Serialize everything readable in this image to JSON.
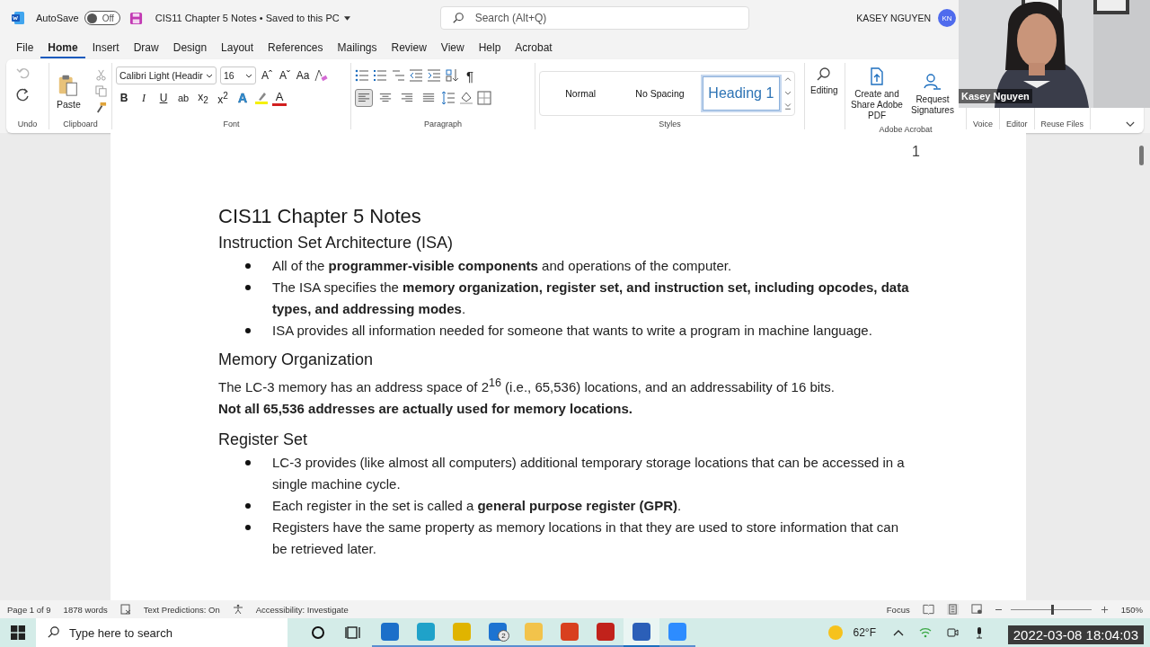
{
  "title_bar": {
    "autosave_label": "AutoSave",
    "autosave_on": false,
    "autosave_state": "Off",
    "doc_title": "CIS11 Chapter 5 Notes • Saved to this PC",
    "search_placeholder": "Search (Alt+Q)",
    "user_name": "KASEY NGUYEN",
    "user_initials": "KN"
  },
  "menu_tabs": [
    {
      "label": "File",
      "selected": false
    },
    {
      "label": "Home",
      "selected": true
    },
    {
      "label": "Insert",
      "selected": false
    },
    {
      "label": "Draw",
      "selected": false
    },
    {
      "label": "Design",
      "selected": false
    },
    {
      "label": "Layout",
      "selected": false
    },
    {
      "label": "References",
      "selected": false
    },
    {
      "label": "Mailings",
      "selected": false
    },
    {
      "label": "Review",
      "selected": false
    },
    {
      "label": "View",
      "selected": false
    },
    {
      "label": "Help",
      "selected": false
    },
    {
      "label": "Acrobat",
      "selected": false
    }
  ],
  "ribbon": {
    "undo": {
      "label": "Undo"
    },
    "clipboard": {
      "paste": "Paste",
      "label": "Clipboard"
    },
    "font": {
      "font_name": "Calibri Light (Headir",
      "font_size": "16",
      "size_tools": [
        "Aˆ",
        "Aˇ",
        "Aa"
      ],
      "format_buttons": [
        {
          "kind": "bold",
          "label": "B"
        },
        {
          "kind": "italic",
          "label": "I"
        },
        {
          "kind": "underline",
          "label": "U"
        },
        {
          "kind": "strike",
          "label": "ab"
        },
        {
          "kind": "sub",
          "label": "x$_{2}$"
        },
        {
          "kind": "sup",
          "label": "x$^{2}$"
        },
        {
          "kind": "effects",
          "label": "A"
        }
      ],
      "font_color_label": "A",
      "label": "Font"
    },
    "paragraph": {
      "pilcrow": "¶",
      "alignments": [
        {
          "kind": "left",
          "selected": true
        },
        {
          "kind": "center",
          "selected": false
        },
        {
          "kind": "right",
          "selected": false
        },
        {
          "kind": "justify",
          "selected": false
        }
      ],
      "label": "Paragraph"
    },
    "styles": {
      "items": [
        {
          "label": "Normal",
          "selected": false
        },
        {
          "label": "No Spacing",
          "selected": false
        },
        {
          "label": "Heading 1",
          "selected": true
        }
      ],
      "label": "Styles"
    },
    "editing": {
      "label": "Editing"
    },
    "acrobat": {
      "buttons": [
        "Create and Share Adobe PDF",
        "Request Signatures"
      ],
      "label": "Adobe Acrobat"
    },
    "hidden_group_labels": [
      "Voice",
      "Editor",
      "Reuse Files"
    ]
  },
  "document": {
    "page_number": "1",
    "title": "CIS11 Chapter 5 Notes",
    "blocks": [
      {
        "kind": "heading",
        "text": "Instruction Set Architecture (ISA)"
      },
      {
        "kind": "bullets",
        "items": [
          "All of the **programmer-visible components** and operations of the computer.",
          "The ISA specifies the **memory organization, register set, and instruction set, including opcodes, data types, and addressing modes**.",
          "ISA provides all information needed for someone that wants to write a program in machine language."
        ]
      },
      {
        "kind": "heading",
        "text": "Memory Organization"
      },
      {
        "kind": "paragraph",
        "bold": false,
        "text": "The LC-3 memory has an address space of 2$^{16}$ (i.e., 65,536) locations, and an addressability of 16 bits."
      },
      {
        "kind": "paragraph",
        "bold": true,
        "text": "Not all 65,536 addresses are actually used for memory locations."
      },
      {
        "kind": "heading",
        "text": "Register Set"
      },
      {
        "kind": "bullets",
        "items": [
          "LC-3 provides (like almost all computers) additional temporary storage locations that can be accessed in a single machine cycle.",
          "Each register in the set is called a **general purpose register (GPR)**.",
          "Registers have the same property as memory locations in that they are used to store information that can be retrieved later."
        ]
      }
    ]
  },
  "status_bar": {
    "page": "Page 1 of 9",
    "words": "1878 words",
    "text_predictions": "Text Predictions: On",
    "accessibility": "Accessibility: Investigate",
    "focus": "Focus",
    "zoom_slider": {
      "level": 0.52
    },
    "zoom": "150%"
  },
  "taskbar": {
    "search_placeholder": "Type here to search",
    "apps": [
      {
        "kind": "store",
        "selected": false
      },
      {
        "kind": "edge",
        "selected": false
      },
      {
        "kind": "chrome",
        "selected": false
      },
      {
        "kind": "mail",
        "selected": false,
        "badge": "2"
      },
      {
        "kind": "files",
        "selected": false
      },
      {
        "kind": "office",
        "selected": false
      },
      {
        "kind": "pdf",
        "selected": false
      },
      {
        "kind": "word",
        "selected": true
      },
      {
        "kind": "zoom",
        "selected": false
      }
    ],
    "weather": "62°F"
  },
  "webcam": {
    "name": "Kasey Nguyen"
  },
  "recording_timestamp": "2022-03-08 18:04:03"
}
